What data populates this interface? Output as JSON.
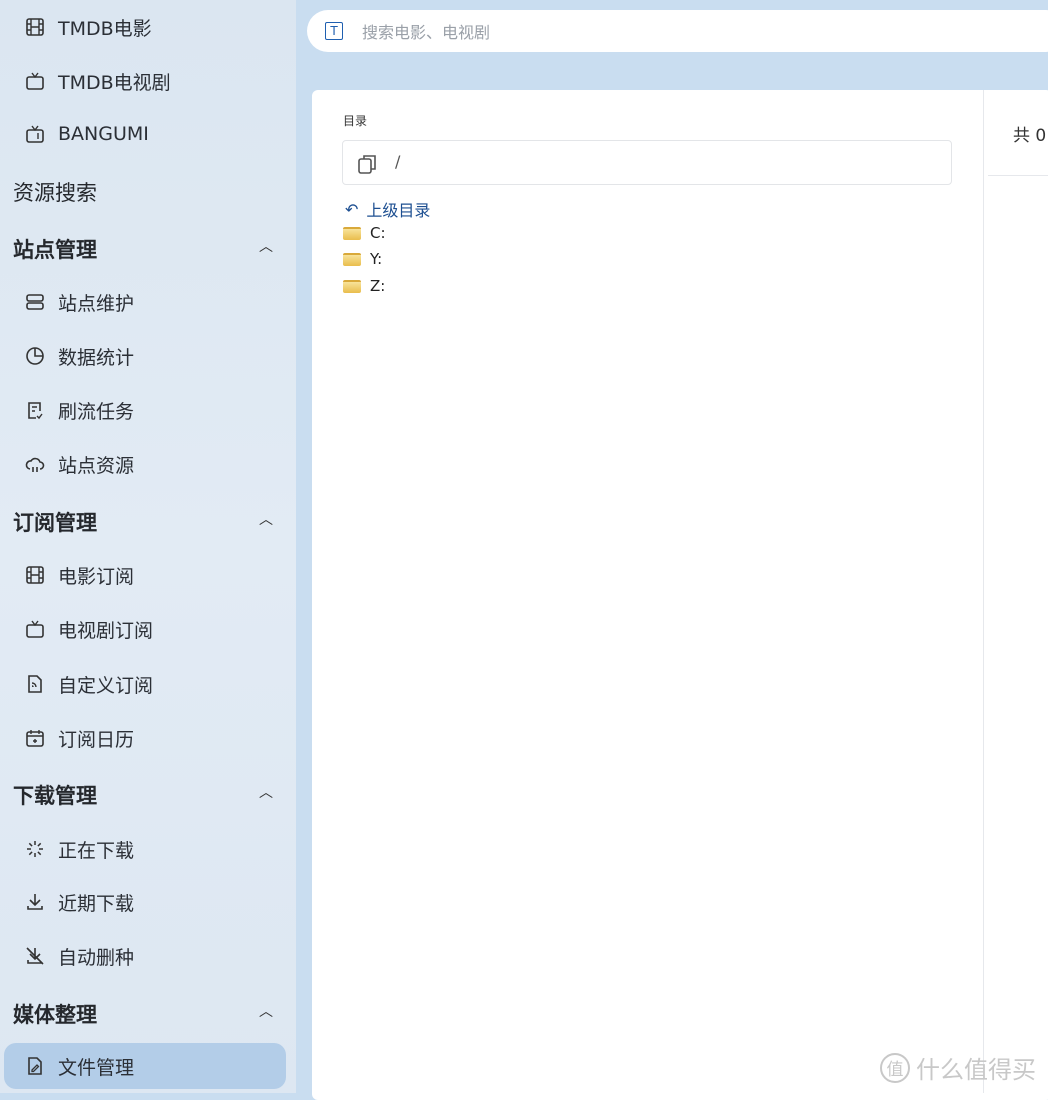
{
  "sidebar": {
    "items": [
      {
        "label": "TMDB电影",
        "icon": "film-icon"
      },
      {
        "label": "TMDB电视剧",
        "icon": "tv-icon"
      },
      {
        "label": "BANGUMI",
        "icon": "tv-retro-icon"
      },
      {
        "label": "资源搜索"
      },
      {
        "label": "站点管理"
      },
      {
        "label": "站点维护",
        "icon": "server-icon"
      },
      {
        "label": "数据统计",
        "icon": "pie-chart-icon"
      },
      {
        "label": "刷流任务",
        "icon": "task-icon"
      },
      {
        "label": "站点资源",
        "icon": "cloud-icon"
      },
      {
        "label": "订阅管理"
      },
      {
        "label": "电影订阅",
        "icon": "film-icon"
      },
      {
        "label": "电视剧订阅",
        "icon": "tv-icon"
      },
      {
        "label": "自定义订阅",
        "icon": "rss-file-icon"
      },
      {
        "label": "订阅日历",
        "icon": "calendar-icon"
      },
      {
        "label": "下载管理"
      },
      {
        "label": "正在下载",
        "icon": "loading-icon"
      },
      {
        "label": "近期下载",
        "icon": "download-icon"
      },
      {
        "label": "自动删种",
        "icon": "download-off-icon"
      },
      {
        "label": "媒体整理"
      },
      {
        "label": "文件管理",
        "icon": "file-edit-icon",
        "active": true
      }
    ]
  },
  "search": {
    "placeholder": "搜索电影、电视剧",
    "icon_letter": "T"
  },
  "browser": {
    "dir_label": "目录",
    "path": "/",
    "up_label": "上级目录",
    "folders": [
      "C:",
      "Y:",
      "Z:"
    ]
  },
  "right": {
    "count": "共 0"
  },
  "watermark": {
    "logo": "值",
    "text": "什么值得买"
  },
  "colors": {
    "accent": "#1d4f91",
    "active_bg": "#b3cde8"
  }
}
